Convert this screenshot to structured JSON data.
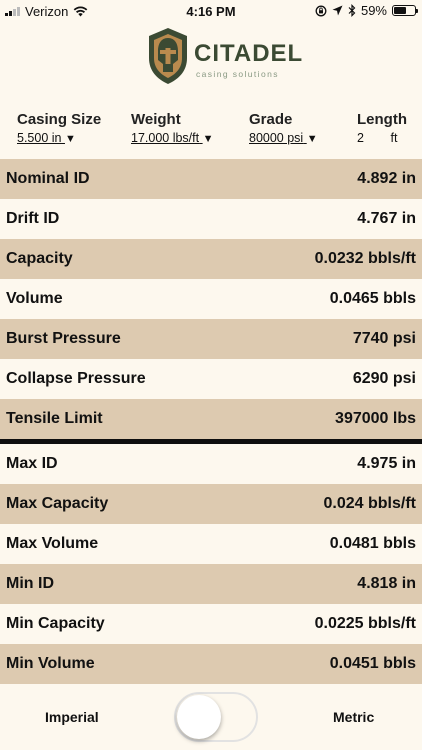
{
  "status_bar": {
    "carrier": "Verizon",
    "time": "4:16 PM",
    "battery": "59%",
    "battery_level": 0.59
  },
  "logo": {
    "name": "CITADEL",
    "tagline": "casing solutions"
  },
  "selectors": {
    "casing_size": {
      "label": "Casing Size",
      "value": "5.500 in"
    },
    "weight": {
      "label": "Weight",
      "value": "17.000 lbs/ft"
    },
    "grade": {
      "label": "Grade",
      "value": "80000 psi"
    },
    "length": {
      "label": "Length",
      "value": "2",
      "unit": "ft"
    }
  },
  "results": [
    {
      "label": "Nominal ID",
      "value": "4.892 in"
    },
    {
      "label": "Drift ID",
      "value": "4.767 in"
    },
    {
      "label": "Capacity",
      "value": "0.0232 bbls/ft"
    },
    {
      "label": "Volume",
      "value": "0.0465 bbls"
    },
    {
      "label": "Burst Pressure",
      "value": "7740 psi"
    },
    {
      "label": "Collapse Pressure",
      "value": "6290 psi"
    },
    {
      "label": "Tensile Limit",
      "value": "397000 lbs"
    }
  ],
  "tolerances": [
    {
      "label": "Max ID",
      "value": "4.975 in"
    },
    {
      "label": "Max Capacity",
      "value": "0.024 bbls/ft"
    },
    {
      "label": "Max Volume",
      "value": "0.0481 bbls"
    },
    {
      "label": "Min ID",
      "value": "4.818 in"
    },
    {
      "label": "Min Capacity",
      "value": "0.0225 bbls/ft"
    },
    {
      "label": "Min Volume",
      "value": "0.0451 bbls"
    }
  ],
  "units": {
    "imperial": "Imperial",
    "metric": "Metric"
  },
  "colors": {
    "row_shade": "#ddcab0",
    "background": "#fdf8ee",
    "logo_dark": "#3b4a33",
    "logo_accent": "#b98a4e"
  }
}
